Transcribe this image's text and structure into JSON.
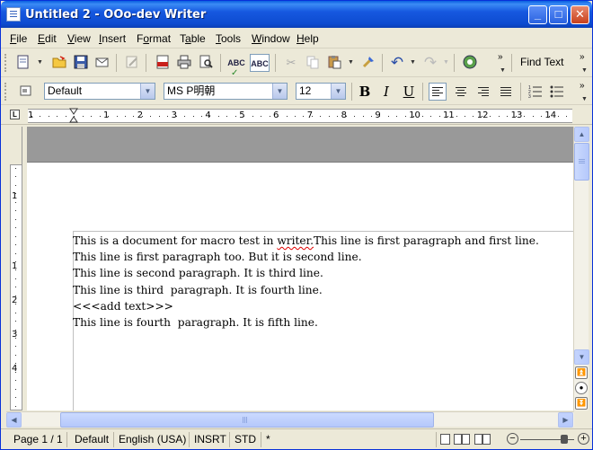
{
  "window": {
    "title": "Untitled 2 - OOo-dev Writer"
  },
  "menu": [
    {
      "label": "File",
      "key": "F",
      "rest": "ile"
    },
    {
      "label": "Edit",
      "key": "E",
      "rest": "dit"
    },
    {
      "label": "View",
      "key": "V",
      "rest": "iew"
    },
    {
      "label": "Insert",
      "key": "I",
      "rest": "nsert"
    },
    {
      "label": "Format",
      "key": "o",
      "pre": "F",
      "rest": "rmat"
    },
    {
      "label": "Table",
      "key": "a",
      "pre": "T",
      "rest": "ble"
    },
    {
      "label": "Tools",
      "key": "T",
      "rest": "ools"
    },
    {
      "label": "Window",
      "key": "W",
      "rest": "indow"
    },
    {
      "label": "Help",
      "key": "H",
      "rest": "elp"
    }
  ],
  "toolbar": {
    "find_text": "Find Text"
  },
  "format": {
    "style": "Default",
    "font": "MS P明朝",
    "size": "12",
    "bold": "B",
    "italic": "I",
    "underline": "U"
  },
  "ruler": {
    "numbers": [
      "1",
      "1",
      "2",
      "3",
      "4",
      "5",
      "6",
      "7",
      "8",
      "9",
      "10",
      "11",
      "12",
      "13",
      "14"
    ],
    "vnumbers": [
      "1",
      "1",
      "2",
      "3",
      "4"
    ]
  },
  "document": {
    "lines": [
      {
        "before": "This is a document for macro test in ",
        "misspelled": "writer.",
        "after": "This line is first paragraph and first line."
      },
      {
        "before": "This line is first paragraph too. But it is second line.",
        "misspelled": "",
        "after": ""
      },
      {
        "before": "This line is second paragraph. It is third line.",
        "misspelled": "",
        "after": ""
      },
      {
        "before": "This line is third  paragraph. It is fourth line.",
        "misspelled": "",
        "after": ""
      },
      {
        "before": "<<<add text>>>",
        "misspelled": "",
        "after": ""
      },
      {
        "before": "This line is fourth  paragraph. It is fifth line.",
        "misspelled": "",
        "after": ""
      }
    ]
  },
  "status": {
    "page": "Page 1 / 1",
    "style": "Default",
    "language": "English (USA)",
    "mode": "INSRT",
    "selection": "STD",
    "modified": "*"
  }
}
